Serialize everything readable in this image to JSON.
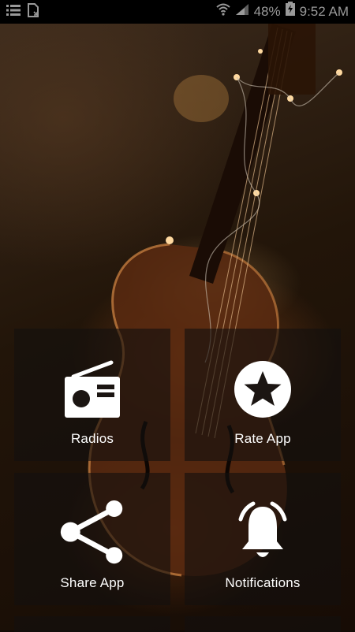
{
  "status_bar": {
    "battery": "48%",
    "time": "9:52 AM",
    "icons": [
      "menu-list-icon",
      "sim-card-icon",
      "wifi-icon",
      "signal-icon",
      "battery-charging-icon"
    ]
  },
  "background": {
    "subject": "violin",
    "accent": "#c97a3a"
  },
  "menu": {
    "items": [
      {
        "label": "Radios",
        "icon": "radio-icon"
      },
      {
        "label": "Rate App",
        "icon": "star-icon"
      },
      {
        "label": "Share App",
        "icon": "share-icon"
      },
      {
        "label": "Notifications",
        "icon": "bell-icon"
      }
    ]
  }
}
